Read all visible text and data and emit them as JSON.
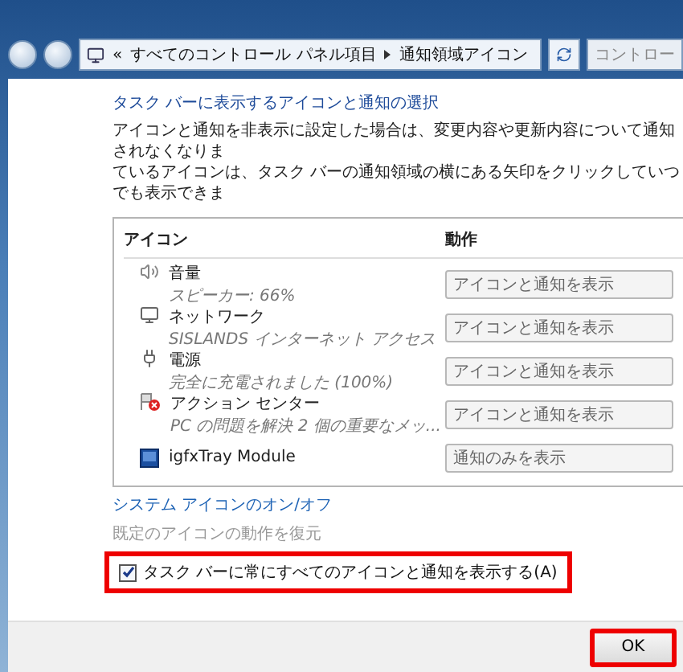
{
  "address_bar": {
    "overflow_marker": "«",
    "breadcrumbs": [
      "すべてのコントロール パネル項目",
      "通知領域アイコン"
    ]
  },
  "search": {
    "placeholder": "コントロー"
  },
  "heading": "タスク バーに表示するアイコンと通知の選択",
  "description": [
    "アイコンと通知を非表示に設定した場合は、変更内容や更新内容について通知されなくなりま",
    "ているアイコンは、タスク バーの通知領域の横にある矢印をクリックしていつでも表示できま"
  ],
  "table": {
    "columns": [
      "アイコン",
      "動作"
    ],
    "rows": [
      {
        "kind": "speaker",
        "name": "音量",
        "detail": "スピーカー: 66%",
        "behavior": "アイコンと通知を表示"
      },
      {
        "kind": "network",
        "name": "ネットワーク",
        "detail": "SISLANDS インターネット アクセス",
        "behavior": "アイコンと通知を表示"
      },
      {
        "kind": "power",
        "name": "電源",
        "detail": "完全に充電されました (100%)",
        "behavior": "アイコンと通知を表示"
      },
      {
        "kind": "action_center",
        "name": "アクション センター",
        "detail": "PC の問題を解決 2 個の重要なメッ...",
        "behavior": "アイコンと通知を表示"
      },
      {
        "kind": "graphics",
        "name": "igfxTray Module",
        "behavior": "通知のみを表示"
      }
    ]
  },
  "links": [
    {
      "label": "システム アイコンのオン/オフ",
      "disabled": false
    },
    {
      "label": "既定のアイコンの動作を復元",
      "disabled": true
    }
  ],
  "always_show": {
    "label": "タスク バーに常にすべてのアイコンと通知を表示する(A)",
    "checked": true,
    "highlighted": true
  },
  "buttons": [
    {
      "label": "OK",
      "highlighted": true
    }
  ]
}
